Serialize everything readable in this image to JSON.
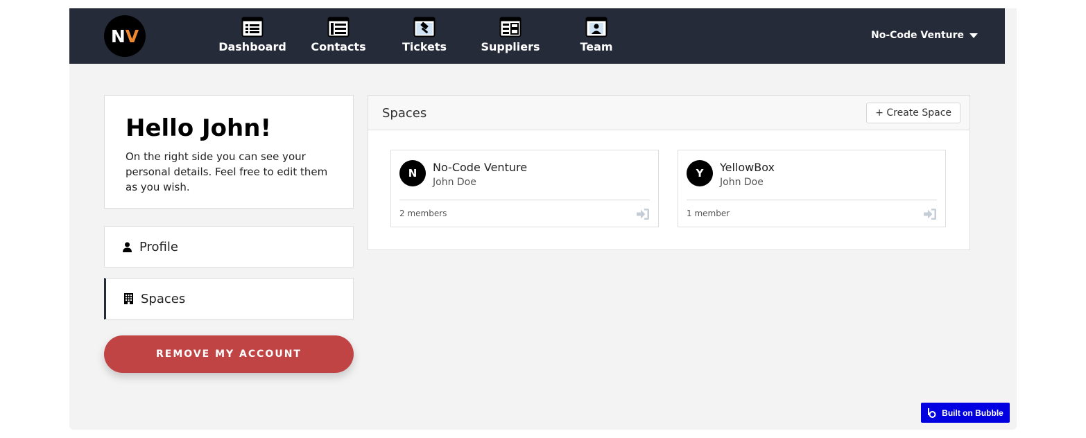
{
  "header": {
    "logo": {
      "letter1": "N",
      "letter2": "V"
    },
    "nav": [
      {
        "label": "Dashboard",
        "icon": "list-icon"
      },
      {
        "label": "Contacts",
        "icon": "contacts-list-icon"
      },
      {
        "label": "Tickets",
        "icon": "ticket-hammer-icon"
      },
      {
        "label": "Suppliers",
        "icon": "suppliers-grid-icon"
      },
      {
        "label": "Team",
        "icon": "id-badge-icon"
      }
    ],
    "account_menu": {
      "label": "No-Code Venture",
      "icon": "caret-down-icon"
    }
  },
  "welcome": {
    "title": "Hello John!",
    "text": "On the right side you can see your personal details. Feel free to edit them as you wish."
  },
  "side_menu": [
    {
      "label": "Profile",
      "icon": "user-icon",
      "active": false
    },
    {
      "label": "Spaces",
      "icon": "building-icon",
      "active": true
    }
  ],
  "remove_account": {
    "label": "REMOVE MY ACCOUNT"
  },
  "spaces_panel": {
    "title": "Spaces",
    "create_label": "+ Create Space",
    "spaces": [
      {
        "initial": "N",
        "name": "No-Code Venture",
        "owner": "John Doe",
        "members": "2 members"
      },
      {
        "initial": "Y",
        "name": "YellowBox",
        "owner": "John Doe",
        "members": "1 member"
      }
    ]
  },
  "badge": {
    "label": "Built on Bubble"
  },
  "colors": {
    "topbar": "#262b3a",
    "logo_accent": "#f0892e",
    "danger": "#c04444",
    "bubble_blue": "#0000e0",
    "background": "#f3f3f3"
  }
}
